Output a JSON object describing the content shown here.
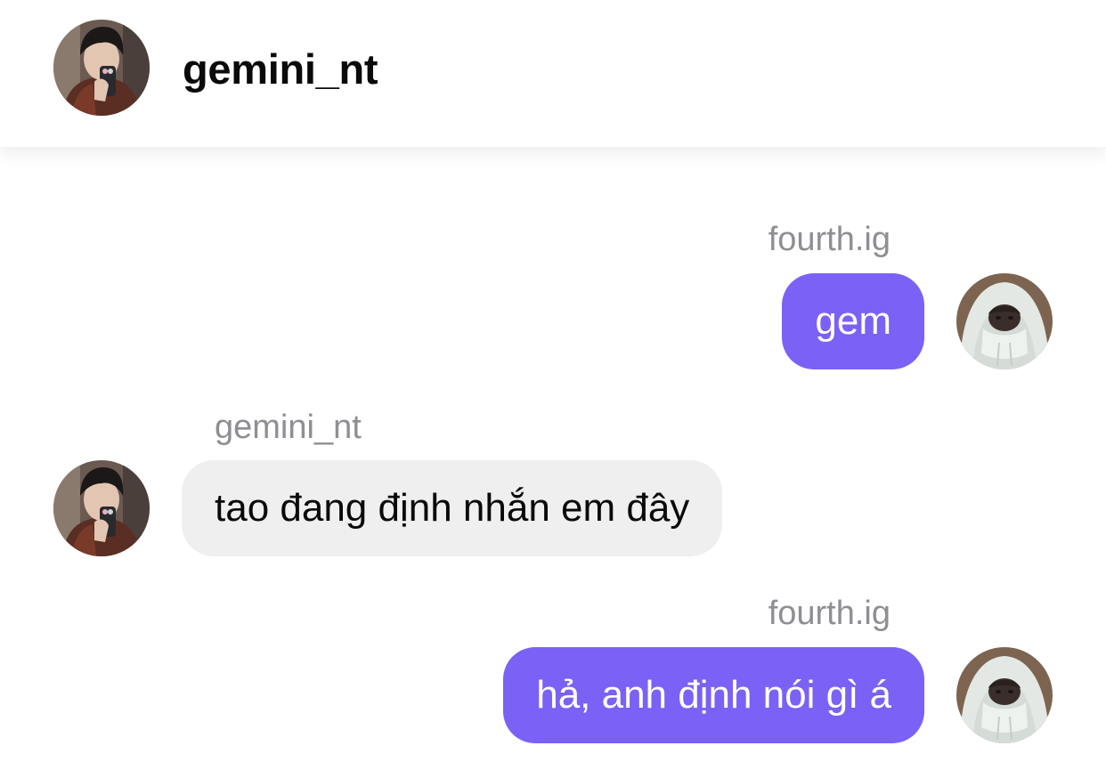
{
  "header": {
    "title": "gemini_nt",
    "avatar_icon": "profile-photo-gemini"
  },
  "colors": {
    "outgoing_bubble": "#7b61f5",
    "incoming_bubble": "#efefef",
    "sender_label": "#8e8e93"
  },
  "messages": [
    {
      "sender": "fourth.ig",
      "text": "gem",
      "direction": "outgoing",
      "avatar_icon": "profile-photo-fourth"
    },
    {
      "sender": "gemini_nt",
      "text": "tao đang định nhắn em đây",
      "direction": "incoming",
      "avatar_icon": "profile-photo-gemini"
    },
    {
      "sender": "fourth.ig",
      "text": "hả, anh định nói gì á",
      "direction": "outgoing",
      "avatar_icon": "profile-photo-fourth"
    }
  ]
}
